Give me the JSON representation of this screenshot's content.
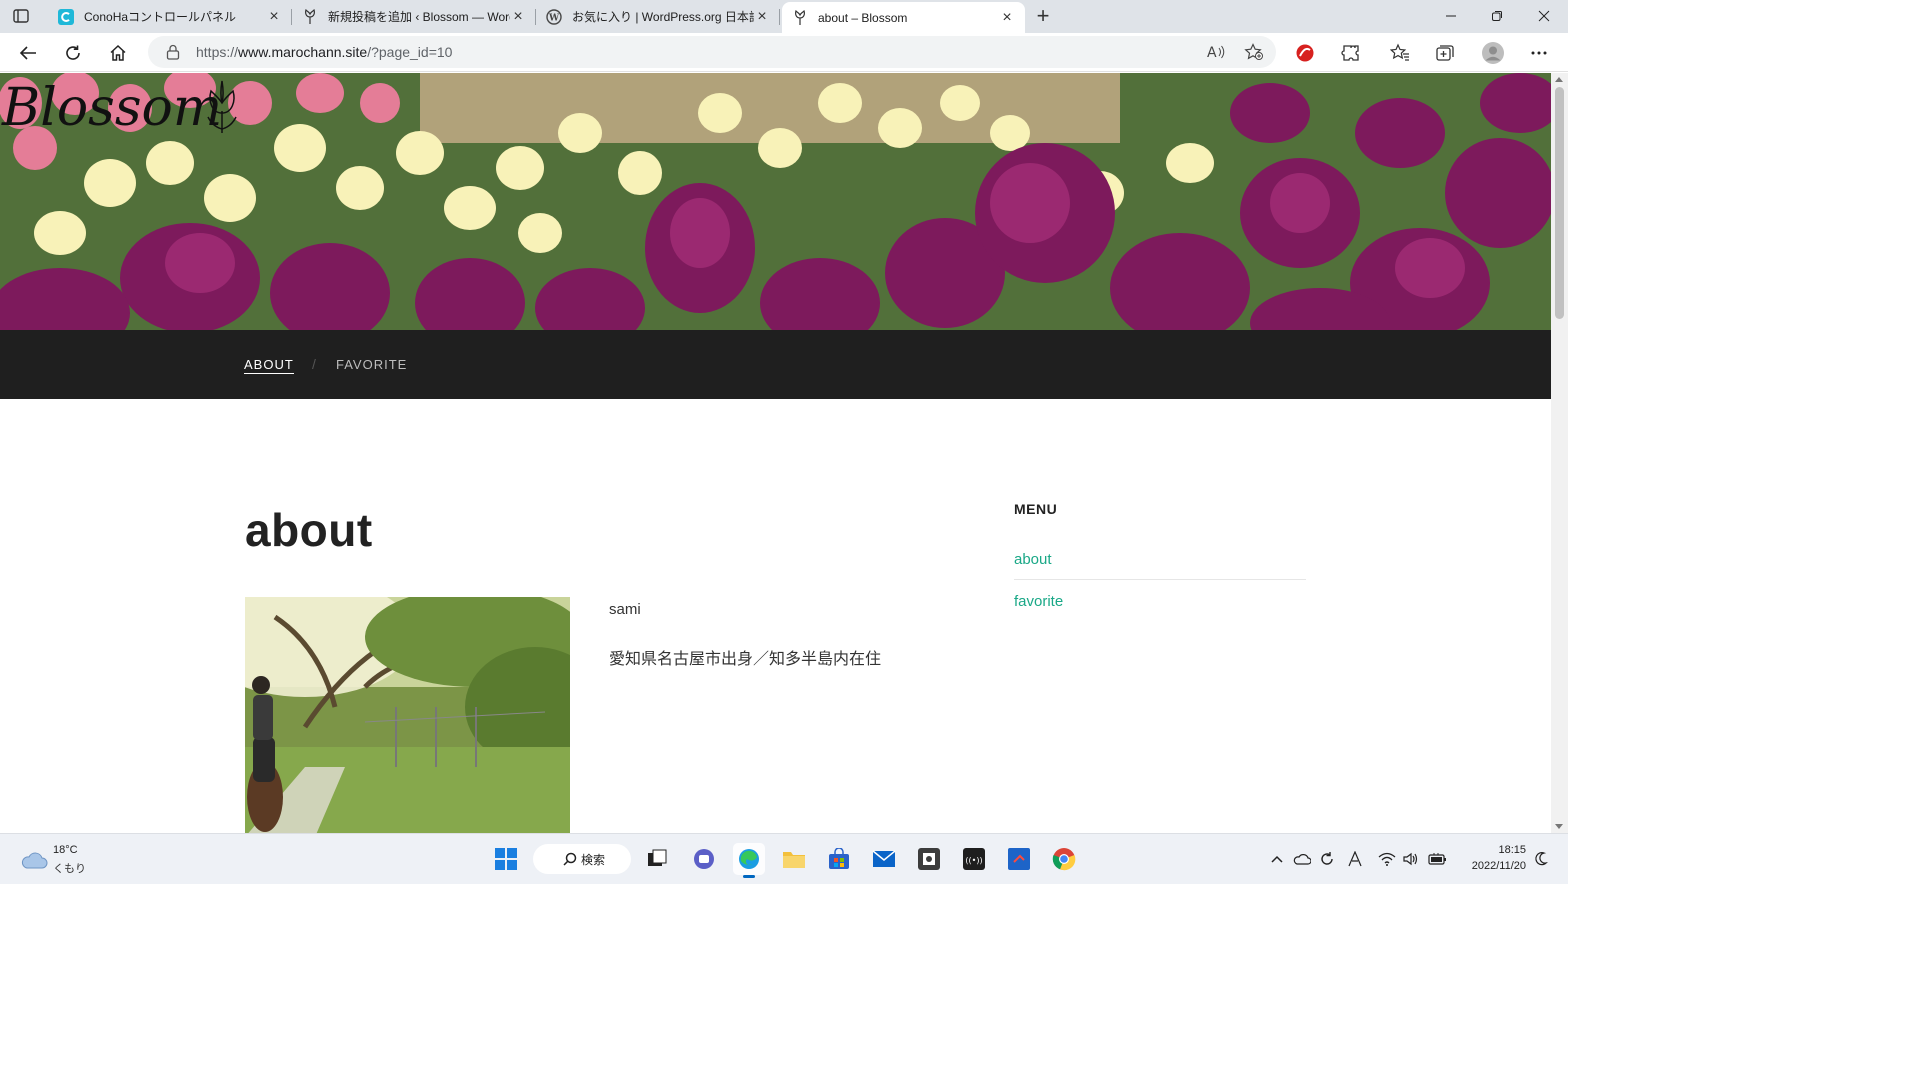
{
  "browser": {
    "tabs": [
      {
        "title": "ConoHaコントロールパネル",
        "favicon": "conoha-icon"
      },
      {
        "title": "新規投稿を追加 ‹ Blossom — WordPress",
        "favicon": "blossom-favicon"
      },
      {
        "title": "お気に入り | WordPress.org 日本語",
        "favicon": "wordpress-icon"
      },
      {
        "title": "about – Blossom",
        "favicon": "blossom-favicon",
        "active": true
      }
    ],
    "address": {
      "prefix": "https://",
      "host": "www.marochann.site",
      "path": "/?page_id=10"
    }
  },
  "site": {
    "logo_text": "Blossom",
    "nav": [
      {
        "label": "ABOUT",
        "current": true
      },
      {
        "label": "FAVORITE",
        "current": false
      }
    ],
    "nav_separator": "/"
  },
  "page": {
    "title": "about",
    "name": "sami",
    "origin": "愛知県名古屋市出身／知多半島内在住"
  },
  "sidebar": {
    "title": "MENU",
    "links": [
      "about",
      "favorite"
    ]
  },
  "taskbar": {
    "weather_temp": "18°C",
    "weather_cond": "くもり",
    "search_label": "検索",
    "time": "18:15",
    "date": "2022/11/20"
  },
  "colors": {
    "link": "#1aa887",
    "navbar": "#1f1f1f",
    "accent": "#0067c0"
  }
}
